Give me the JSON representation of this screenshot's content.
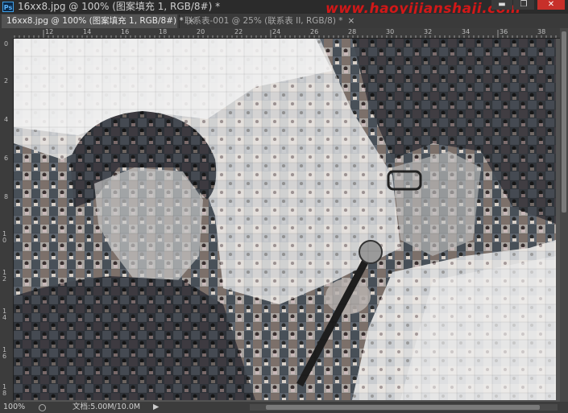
{
  "app": {
    "logo": "Ps"
  },
  "window": {
    "title": "16xx8.jpg @ 100% (图案填充 1, RGB/8#) *",
    "watermark": "www.haoyijianshaji.com",
    "controls": {
      "minimize": "▬",
      "maximize": "❐",
      "close": "✕"
    }
  },
  "tabs": [
    {
      "label": "16xx8.jpg @ 100% (图案填充 1, RGB/8#) *",
      "active": true,
      "close": "×"
    },
    {
      "label": "联系表-001 @ 25% (联系表 II, RGB/8) *",
      "active": false,
      "close": "×"
    }
  ],
  "rulers": {
    "horizontal": [
      "12",
      "14",
      "16",
      "18",
      "20",
      "22",
      "24",
      "26",
      "28",
      "30",
      "32",
      "34",
      "36",
      "38"
    ],
    "vertical": [
      "0",
      "2",
      "4",
      "6",
      "8",
      "10",
      "12",
      "14",
      "16",
      "18"
    ]
  },
  "status": {
    "zoom": "100%",
    "doc": "文档:5.00M/10.0M",
    "arrow": "▶"
  },
  "canvas": {
    "image": "mosaic-portrait-singer-with-microphone"
  }
}
